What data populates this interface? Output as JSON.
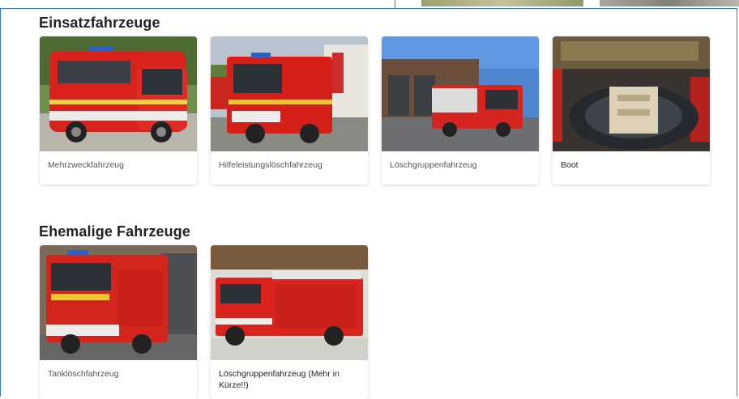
{
  "sections": [
    {
      "title": "Einsatzfahrzeuge",
      "vehicles": [
        {
          "label": "Mehrzweckfahrzeug"
        },
        {
          "label": "Hilfeleistungslöschfahrzeug"
        },
        {
          "label": "Löschgruppenfahrzeug"
        },
        {
          "label": "Boot"
        }
      ]
    },
    {
      "title": "Ehemalige Fahrzeuge",
      "vehicles": [
        {
          "label": "Tanklöschfahrzeug"
        },
        {
          "label": "Löschgruppenfahrzeug (Mehr in Kürze!!)"
        }
      ]
    }
  ],
  "colors": {
    "frame_border": "#2f7fc2",
    "fire_red": "#d7261e",
    "heading": "#1f2328"
  }
}
